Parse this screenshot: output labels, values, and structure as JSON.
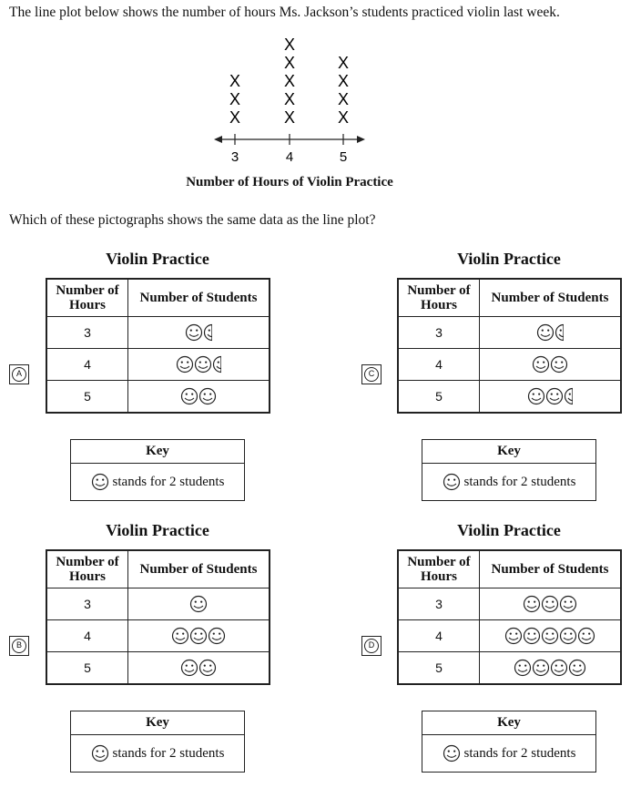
{
  "stem": "The line plot below shows the number of hours Ms. Jackson’s students practiced violin last week.",
  "line_plot": {
    "xlabel": "Number of Hours of Violin Practice",
    "points": [
      {
        "x": 3,
        "count": 3
      },
      {
        "x": 4,
        "count": 5
      },
      {
        "x": 5,
        "count": 4
      }
    ],
    "marker": "X"
  },
  "question": "Which of these pictographs shows the same data as the line plot?",
  "key_students_per_face": 2,
  "options": [
    {
      "letter": "A",
      "title": "Violin Practice",
      "col1": "Number of Hours",
      "col2": "Number of Students",
      "rows": [
        {
          "hours": "3",
          "faces": 1.5
        },
        {
          "hours": "4",
          "faces": 2.5
        },
        {
          "hours": "5",
          "faces": 2
        }
      ],
      "key_title": "Key",
      "key_text": "stands for 2 students"
    },
    {
      "letter": "B",
      "title": "Violin Practice",
      "col1": "Number of Hours",
      "col2": "Number of Students",
      "rows": [
        {
          "hours": "3",
          "faces": 1
        },
        {
          "hours": "4",
          "faces": 3
        },
        {
          "hours": "5",
          "faces": 2
        }
      ],
      "key_title": "Key",
      "key_text": "stands for 2 students"
    },
    {
      "letter": "C",
      "title": "Violin Practice",
      "col1": "Number of Hours",
      "col2": "Number of Students",
      "rows": [
        {
          "hours": "3",
          "faces": 1.5
        },
        {
          "hours": "4",
          "faces": 2
        },
        {
          "hours": "5",
          "faces": 2.5
        }
      ],
      "key_title": "Key",
      "key_text": "stands for 2 students"
    },
    {
      "letter": "D",
      "title": "Violin Practice",
      "col1": "Number of Hours",
      "col2": "Number of Students",
      "rows": [
        {
          "hours": "3",
          "faces": 3
        },
        {
          "hours": "4",
          "faces": 5
        },
        {
          "hours": "5",
          "faces": 4
        }
      ],
      "key_title": "Key",
      "key_text": "stands for 2 students"
    }
  ]
}
